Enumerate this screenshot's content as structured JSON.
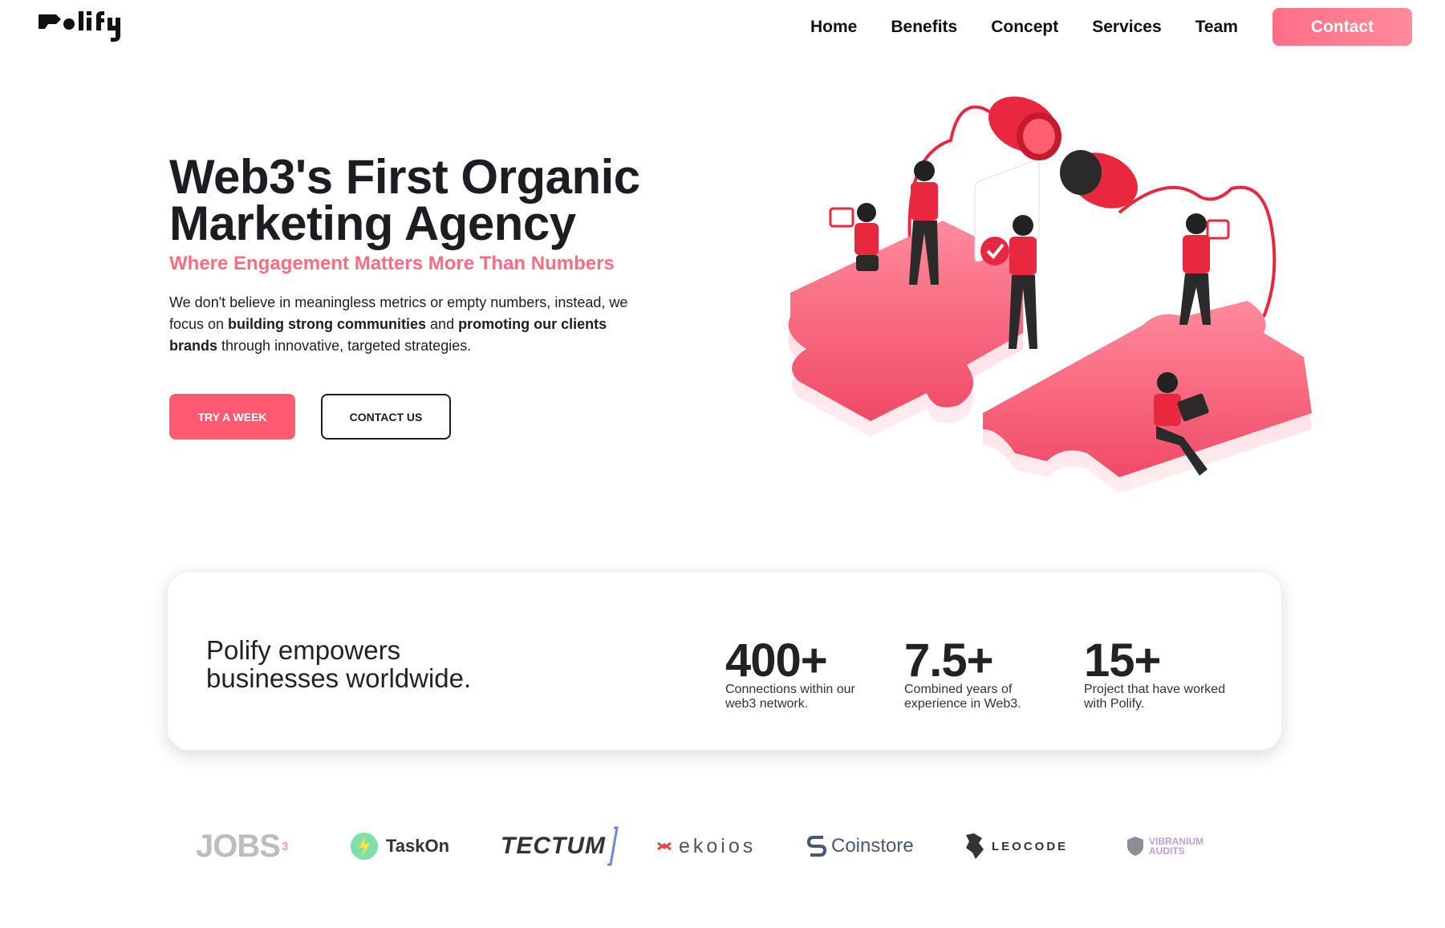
{
  "brand": {
    "name": "Polify"
  },
  "nav": {
    "links": [
      "Home",
      "Benefits",
      "Concept",
      "Services",
      "Team"
    ],
    "contact_label": "Contact"
  },
  "hero": {
    "title": "Web3's First Organic Marketing Agency",
    "subtitle": "Where Engagement Matters More Than Numbers",
    "desc_1": "We don't believe in meaningless metrics or empty numbers, instead, we focus on ",
    "desc_b1": "building strong communities",
    "desc_2": " and ",
    "desc_b2": "promoting our clients brands",
    "desc_3": " through innovative, targeted strategies.",
    "btn_try": "TRY A WEEK",
    "btn_contact": "CONTACT US"
  },
  "stats": {
    "heading": "Polify empowers businesses worldwide.",
    "items": [
      {
        "value": "400+",
        "label": "Connections within our web3 network."
      },
      {
        "value": "7.5+",
        "label": "Combined years of experience in Web3."
      },
      {
        "value": "15+",
        "label": "Project that have worked with Polify."
      }
    ]
  },
  "partners": {
    "jobs": "JOBS",
    "jobs_sup": "3",
    "taskon": "TaskOn",
    "tectum": "TECTUM",
    "ekoios": "ekoios",
    "coinstore": "Coinstore",
    "leocode": "LEOCODE",
    "vibranium_1": "VIBRANIUM",
    "vibranium_2": "AUDITS"
  },
  "colors": {
    "accent": "#ff6b82",
    "dark": "#1c1c22"
  }
}
